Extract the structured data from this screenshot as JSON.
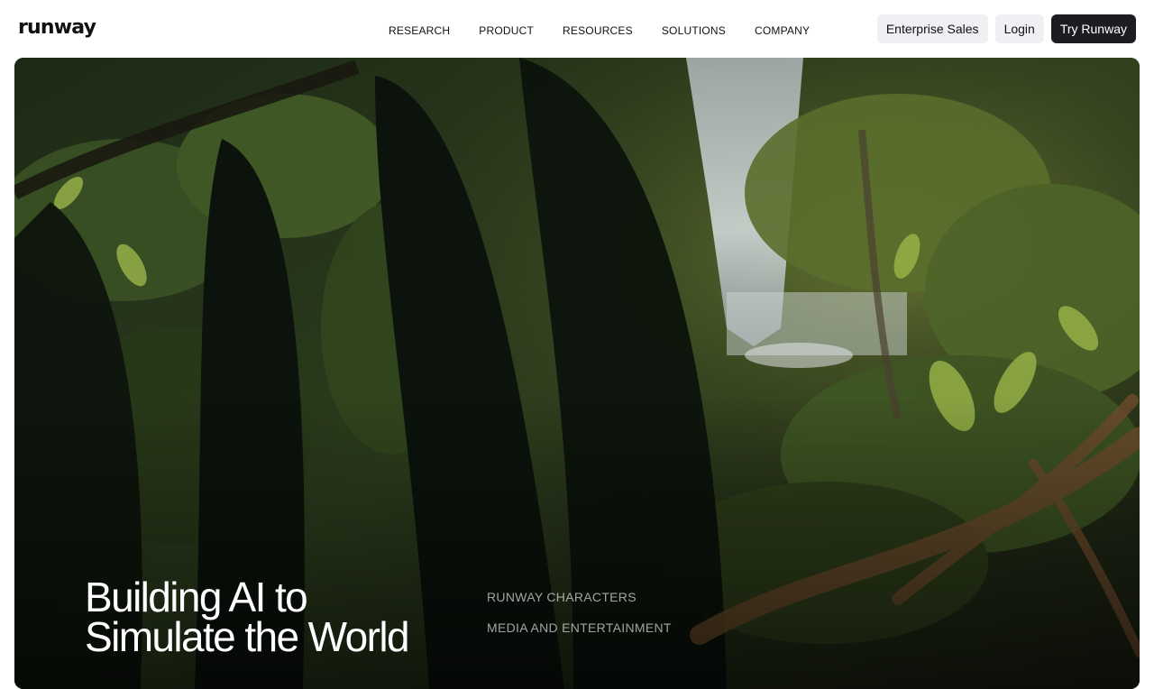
{
  "header": {
    "logo": "runway",
    "nav": [
      "RESEARCH",
      "PRODUCT",
      "RESOURCES",
      "SOLUTIONS",
      "COMPANY"
    ],
    "enterprise_label": "Enterprise Sales",
    "login_label": "Login",
    "try_label": "Try Runway"
  },
  "hero": {
    "headline_line1": "Building AI to",
    "headline_line2": "Simulate the World",
    "links": [
      "RUNWAY CHARACTERS",
      "MEDIA AND ENTERTAINMENT"
    ]
  },
  "colors": {
    "dark_button": "#1c1d21",
    "light_button": "#eef0f3",
    "foliage_dark": "#101611",
    "foliage_green": "#3f5a28",
    "waterfall": "#c8d2d6"
  }
}
